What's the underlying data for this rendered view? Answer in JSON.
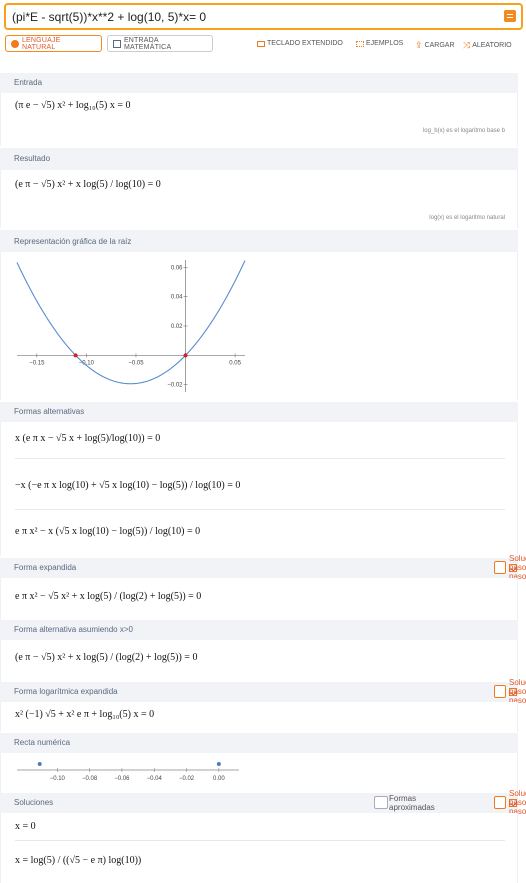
{
  "search": {
    "value": "(pi*E - sqrt(5))*x**2 + log(10, 5)*x= 0"
  },
  "modes": {
    "natural": "LENGUAJE NATURAL",
    "math": "ENTRADA MATEMÁTICA"
  },
  "tools": {
    "keyboard": "TECLADO EXTENDIDO",
    "examples": "EJEMPLOS",
    "upload": "CARGAR",
    "random": "ALEATORIO"
  },
  "sections": {
    "input": {
      "title": "Entrada",
      "expr": "(π e − √5) x² + log₁₀(5) x = 0",
      "note": "log_b(x) es el logaritmo base b"
    },
    "result": {
      "title": "Resultado",
      "expr": "(e π − √5) x² + x log(5) / log(10) = 0",
      "note": "log(x) es el logaritmo natural"
    },
    "plot": {
      "title": "Representación gráfica de la raíz"
    },
    "alt": {
      "title": "Formas alternativas",
      "forms": [
        "x (e π x − √5 x + log(5)/log(10)) = 0",
        "−x (−e π x log(10) + √5 x log(10) − log(5)) / log(10) = 0",
        "e π x² − x (√5 x log(10) − log(5)) / log(10) = 0"
      ]
    },
    "expanded": {
      "title": "Forma expandida",
      "expr": "e π x² − √5 x² + x log(5) / (log(2) + log(5)) = 0"
    },
    "altpos": {
      "title": "Forma alternativa asumiendo x>0",
      "expr": "(e π − √5) x² + x log(5) / (log(2) + log(5)) = 0"
    },
    "logexp": {
      "title": "Forma logarítmica expandida",
      "expr": "x² (−1) √5 + x² e π + log₁₀(5) x = 0"
    },
    "numline": {
      "title": "Recta numérica"
    },
    "solutions": {
      "title": "Soluciones",
      "s1": "x = 0",
      "s2": "x = log(5) / ((√5 − e π) log(10))"
    }
  },
  "buttons": {
    "step": "Solución paso a paso",
    "approx": "Formas aproximadas"
  },
  "chart_data": [
    {
      "type": "line",
      "title": "",
      "xlabel": "",
      "ylabel": "",
      "xlim": [
        -0.17,
        0.06
      ],
      "ylim": [
        -0.025,
        0.065
      ],
      "xticks": [
        "-0.15",
        "-0.10",
        "-0.05",
        "0.05"
      ],
      "yticks": [
        "0.06",
        "0.04",
        "0.02",
        "-0.02"
      ],
      "curve": "y = (πe − √5) x² + log10(5) x",
      "a": 6.3037,
      "b": 0.69897,
      "roots": [
        -0.1109,
        0
      ]
    },
    {
      "type": "scatter",
      "title": "Recta numérica",
      "xlim": [
        -0.12,
        0.01
      ],
      "xticks": [
        "-0.10",
        "-0.08",
        "-0.06",
        "-0.04",
        "-0.02",
        "0.00"
      ],
      "points": [
        -0.1109,
        0
      ]
    }
  ],
  "colors": {
    "accent": "#f28a1c",
    "curve": "#5a8cd0",
    "root": "#d62020",
    "point": "#4a7cc0"
  }
}
